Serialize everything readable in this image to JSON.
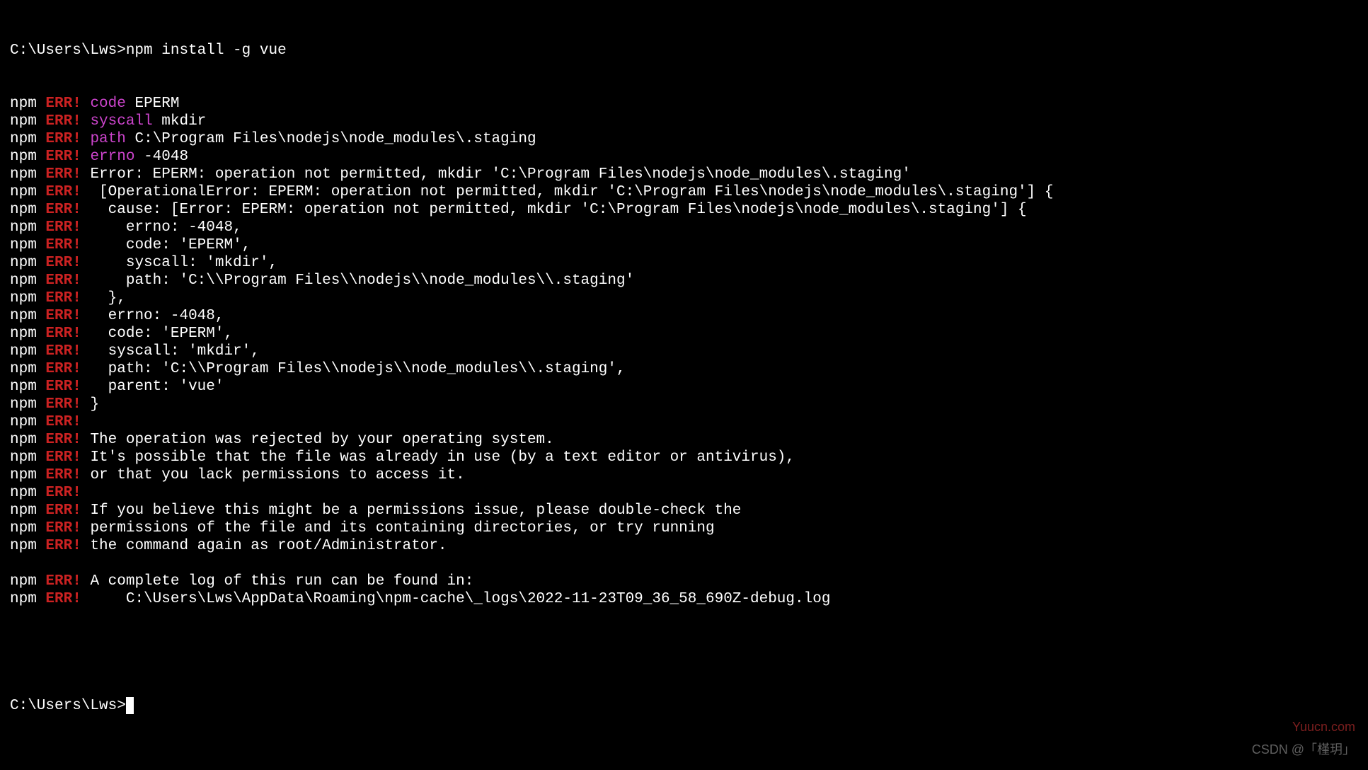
{
  "prompt1": "C:\\Users\\Lws>",
  "command": "npm install -g vue",
  "lines": [
    {
      "parts": [
        {
          "t": "npm",
          "c": "npm"
        },
        {
          "t": " ",
          "c": "text"
        },
        {
          "t": "ERR!",
          "c": "err"
        },
        {
          "t": " ",
          "c": "text"
        },
        {
          "t": "code",
          "c": "key"
        },
        {
          "t": " EPERM",
          "c": "text"
        }
      ]
    },
    {
      "parts": [
        {
          "t": "npm",
          "c": "npm"
        },
        {
          "t": " ",
          "c": "text"
        },
        {
          "t": "ERR!",
          "c": "err"
        },
        {
          "t": " ",
          "c": "text"
        },
        {
          "t": "syscall",
          "c": "key"
        },
        {
          "t": " mkdir",
          "c": "text"
        }
      ]
    },
    {
      "parts": [
        {
          "t": "npm",
          "c": "npm"
        },
        {
          "t": " ",
          "c": "text"
        },
        {
          "t": "ERR!",
          "c": "err"
        },
        {
          "t": " ",
          "c": "text"
        },
        {
          "t": "path",
          "c": "key"
        },
        {
          "t": " C:\\Program Files\\nodejs\\node_modules\\.staging",
          "c": "text"
        }
      ]
    },
    {
      "parts": [
        {
          "t": "npm",
          "c": "npm"
        },
        {
          "t": " ",
          "c": "text"
        },
        {
          "t": "ERR!",
          "c": "err"
        },
        {
          "t": " ",
          "c": "text"
        },
        {
          "t": "errno",
          "c": "key"
        },
        {
          "t": " -4048",
          "c": "text"
        }
      ]
    },
    {
      "parts": [
        {
          "t": "npm",
          "c": "npm"
        },
        {
          "t": " ",
          "c": "text"
        },
        {
          "t": "ERR!",
          "c": "err"
        },
        {
          "t": " Error: EPERM: operation not permitted, mkdir 'C:\\Program Files\\nodejs\\node_modules\\.staging'",
          "c": "text"
        }
      ]
    },
    {
      "parts": [
        {
          "t": "npm",
          "c": "npm"
        },
        {
          "t": " ",
          "c": "text"
        },
        {
          "t": "ERR!",
          "c": "err"
        },
        {
          "t": "  [OperationalError: EPERM: operation not permitted, mkdir 'C:\\Program Files\\nodejs\\node_modules\\.staging'] {",
          "c": "text"
        }
      ]
    },
    {
      "parts": [
        {
          "t": "npm",
          "c": "npm"
        },
        {
          "t": " ",
          "c": "text"
        },
        {
          "t": "ERR!",
          "c": "err"
        },
        {
          "t": "   cause: [Error: EPERM: operation not permitted, mkdir 'C:\\Program Files\\nodejs\\node_modules\\.staging'] {",
          "c": "text"
        }
      ]
    },
    {
      "parts": [
        {
          "t": "npm",
          "c": "npm"
        },
        {
          "t": " ",
          "c": "text"
        },
        {
          "t": "ERR!",
          "c": "err"
        },
        {
          "t": "     errno: -4048,",
          "c": "text"
        }
      ]
    },
    {
      "parts": [
        {
          "t": "npm",
          "c": "npm"
        },
        {
          "t": " ",
          "c": "text"
        },
        {
          "t": "ERR!",
          "c": "err"
        },
        {
          "t": "     code: 'EPERM',",
          "c": "text"
        }
      ]
    },
    {
      "parts": [
        {
          "t": "npm",
          "c": "npm"
        },
        {
          "t": " ",
          "c": "text"
        },
        {
          "t": "ERR!",
          "c": "err"
        },
        {
          "t": "     syscall: 'mkdir',",
          "c": "text"
        }
      ]
    },
    {
      "parts": [
        {
          "t": "npm",
          "c": "npm"
        },
        {
          "t": " ",
          "c": "text"
        },
        {
          "t": "ERR!",
          "c": "err"
        },
        {
          "t": "     path: 'C:\\\\Program Files\\\\nodejs\\\\node_modules\\\\.staging'",
          "c": "text"
        }
      ]
    },
    {
      "parts": [
        {
          "t": "npm",
          "c": "npm"
        },
        {
          "t": " ",
          "c": "text"
        },
        {
          "t": "ERR!",
          "c": "err"
        },
        {
          "t": "   },",
          "c": "text"
        }
      ]
    },
    {
      "parts": [
        {
          "t": "npm",
          "c": "npm"
        },
        {
          "t": " ",
          "c": "text"
        },
        {
          "t": "ERR!",
          "c": "err"
        },
        {
          "t": "   errno: -4048,",
          "c": "text"
        }
      ]
    },
    {
      "parts": [
        {
          "t": "npm",
          "c": "npm"
        },
        {
          "t": " ",
          "c": "text"
        },
        {
          "t": "ERR!",
          "c": "err"
        },
        {
          "t": "   code: 'EPERM',",
          "c": "text"
        }
      ]
    },
    {
      "parts": [
        {
          "t": "npm",
          "c": "npm"
        },
        {
          "t": " ",
          "c": "text"
        },
        {
          "t": "ERR!",
          "c": "err"
        },
        {
          "t": "   syscall: 'mkdir',",
          "c": "text"
        }
      ]
    },
    {
      "parts": [
        {
          "t": "npm",
          "c": "npm"
        },
        {
          "t": " ",
          "c": "text"
        },
        {
          "t": "ERR!",
          "c": "err"
        },
        {
          "t": "   path: 'C:\\\\Program Files\\\\nodejs\\\\node_modules\\\\.staging',",
          "c": "text"
        }
      ]
    },
    {
      "parts": [
        {
          "t": "npm",
          "c": "npm"
        },
        {
          "t": " ",
          "c": "text"
        },
        {
          "t": "ERR!",
          "c": "err"
        },
        {
          "t": "   parent: 'vue'",
          "c": "text"
        }
      ]
    },
    {
      "parts": [
        {
          "t": "npm",
          "c": "npm"
        },
        {
          "t": " ",
          "c": "text"
        },
        {
          "t": "ERR!",
          "c": "err"
        },
        {
          "t": " }",
          "c": "text"
        }
      ]
    },
    {
      "parts": [
        {
          "t": "npm",
          "c": "npm"
        },
        {
          "t": " ",
          "c": "text"
        },
        {
          "t": "ERR!",
          "c": "err"
        }
      ]
    },
    {
      "parts": [
        {
          "t": "npm",
          "c": "npm"
        },
        {
          "t": " ",
          "c": "text"
        },
        {
          "t": "ERR!",
          "c": "err"
        },
        {
          "t": " The operation was rejected by your operating system.",
          "c": "text"
        }
      ]
    },
    {
      "parts": [
        {
          "t": "npm",
          "c": "npm"
        },
        {
          "t": " ",
          "c": "text"
        },
        {
          "t": "ERR!",
          "c": "err"
        },
        {
          "t": " It's possible that the file was already in use (by a text editor or antivirus),",
          "c": "text"
        }
      ]
    },
    {
      "parts": [
        {
          "t": "npm",
          "c": "npm"
        },
        {
          "t": " ",
          "c": "text"
        },
        {
          "t": "ERR!",
          "c": "err"
        },
        {
          "t": " or that you lack permissions to access it.",
          "c": "text"
        }
      ]
    },
    {
      "parts": [
        {
          "t": "npm",
          "c": "npm"
        },
        {
          "t": " ",
          "c": "text"
        },
        {
          "t": "ERR!",
          "c": "err"
        }
      ]
    },
    {
      "parts": [
        {
          "t": "npm",
          "c": "npm"
        },
        {
          "t": " ",
          "c": "text"
        },
        {
          "t": "ERR!",
          "c": "err"
        },
        {
          "t": " If you believe this might be a permissions issue, please double-check the",
          "c": "text"
        }
      ]
    },
    {
      "parts": [
        {
          "t": "npm",
          "c": "npm"
        },
        {
          "t": " ",
          "c": "text"
        },
        {
          "t": "ERR!",
          "c": "err"
        },
        {
          "t": " permissions of the file and its containing directories, or try running",
          "c": "text"
        }
      ]
    },
    {
      "parts": [
        {
          "t": "npm",
          "c": "npm"
        },
        {
          "t": " ",
          "c": "text"
        },
        {
          "t": "ERR!",
          "c": "err"
        },
        {
          "t": " the command again as root/Administrator.",
          "c": "text"
        }
      ]
    },
    {
      "parts": []
    },
    {
      "parts": [
        {
          "t": "npm",
          "c": "npm"
        },
        {
          "t": " ",
          "c": "text"
        },
        {
          "t": "ERR!",
          "c": "err"
        },
        {
          "t": " A complete log of this run can be found in:",
          "c": "text"
        }
      ]
    },
    {
      "parts": [
        {
          "t": "npm",
          "c": "npm"
        },
        {
          "t": " ",
          "c": "text"
        },
        {
          "t": "ERR!",
          "c": "err"
        },
        {
          "t": "     C:\\Users\\Lws\\AppData\\Roaming\\npm-cache\\_logs\\2022-11-23T09_36_58_690Z-debug.log",
          "c": "text"
        }
      ]
    }
  ],
  "prompt2": "C:\\Users\\Lws>",
  "watermark_yuucn": "Yuucn.com",
  "watermark_small und": "",
  "watermark_csdn": "CSDN @「槿玥」"
}
